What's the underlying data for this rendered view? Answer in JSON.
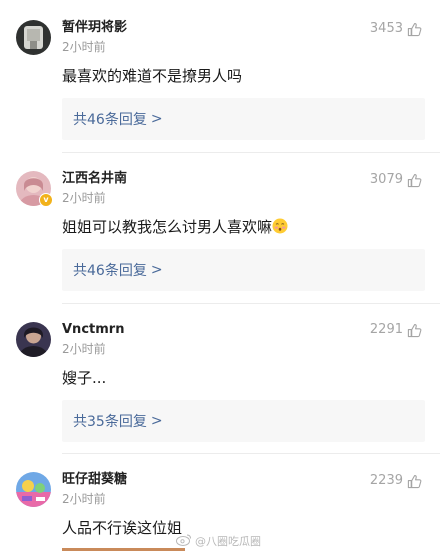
{
  "comments": [
    {
      "username": "暂伴玥将影",
      "time": "2小时前",
      "likes": "3453",
      "content": "最喜欢的难道不是撩男人吗",
      "replies": "共46条回复",
      "avatar": "avatar-grey-figure",
      "verified": false
    },
    {
      "username": "江西名井南",
      "time": "2小时前",
      "likes": "3079",
      "content": "姐姐可以教我怎么讨男人喜欢嘛",
      "emoji": "blush-emoji",
      "replies": "共46条回复",
      "avatar": "avatar-pink-portrait",
      "verified": true
    },
    {
      "username": "Vnctmrn",
      "time": "2小时前",
      "likes": "2291",
      "content": "嫂子...",
      "replies": "共35条回复",
      "avatar": "avatar-dark-portrait",
      "verified": false
    },
    {
      "username": "旺仔甜葵糖",
      "time": "2小时前",
      "likes": "2239",
      "content": "人品不行诶这位姐",
      "avatar": "avatar-colorful-cartoon",
      "verified": false
    }
  ],
  "watermark": "@八圈吃瓜圈",
  "colors": {
    "reply_link": "#4a6a9a",
    "reply_bg": "#f7f7f7",
    "muted": "#9a9a9a",
    "verified_badge": "#f2b21b"
  }
}
